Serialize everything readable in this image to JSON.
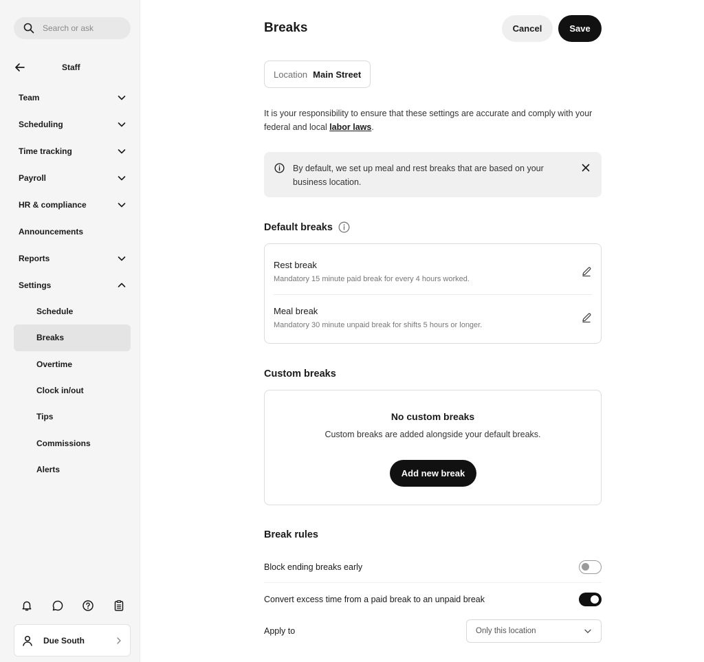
{
  "sidebar": {
    "search_placeholder": "Search or ask",
    "section_title": "Staff",
    "nav": [
      {
        "label": "Team"
      },
      {
        "label": "Scheduling"
      },
      {
        "label": "Time tracking"
      },
      {
        "label": "Payroll"
      },
      {
        "label": "HR & compliance"
      },
      {
        "label": "Announcements"
      },
      {
        "label": "Reports"
      },
      {
        "label": "Settings"
      }
    ],
    "settings_items": [
      {
        "label": "Schedule"
      },
      {
        "label": "Breaks"
      },
      {
        "label": "Overtime"
      },
      {
        "label": "Clock in/out"
      },
      {
        "label": "Tips"
      },
      {
        "label": "Commissions"
      },
      {
        "label": "Alerts"
      }
    ],
    "active_item": "Breaks",
    "footer_icons": [
      "bell-icon",
      "chat-icon",
      "help-icon",
      "clipboard-icon"
    ],
    "user": {
      "name": "Due South"
    }
  },
  "header": {
    "title": "Breaks",
    "cancel_label": "Cancel",
    "save_label": "Save"
  },
  "location": {
    "label": "Location",
    "value": "Main Street"
  },
  "disclaimer": {
    "text": "It is your responsibility to ensure that these settings are accurate and comply with your federal and local ",
    "link": "labor laws",
    "suffix": "."
  },
  "notice": {
    "text": "By default, we set up meal and rest breaks that are based on your business location."
  },
  "default_breaks": {
    "title": "Default breaks",
    "items": [
      {
        "name": "Rest break",
        "description": "Mandatory 15 minute paid break for every 4 hours worked."
      },
      {
        "name": "Meal break",
        "description": "Mandatory 30 minute unpaid break for shifts 5 hours or longer."
      }
    ]
  },
  "custom_breaks": {
    "title": "Custom breaks",
    "empty_title": "No custom breaks",
    "empty_description": "Custom breaks are added alongside your default breaks.",
    "add_label": "Add new break"
  },
  "break_rules": {
    "title": "Break rules",
    "block_early": {
      "label": "Block ending breaks early",
      "enabled": false
    },
    "convert_excess": {
      "label": "Convert excess time from a paid break to an unpaid break",
      "enabled": true
    },
    "apply_to": {
      "label": "Apply to",
      "selected": "Only this location"
    }
  },
  "colors": {
    "primary": "#111111",
    "sidebar_bg": "#f5f5f5",
    "active_bg": "#e4e4e4",
    "notice_bg": "#f0f0f0"
  }
}
